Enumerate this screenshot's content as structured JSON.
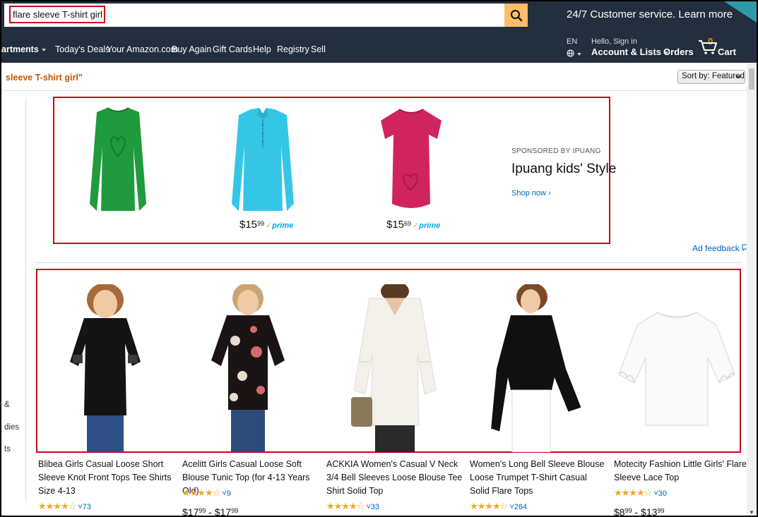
{
  "search": {
    "value": "flare sleeve T-shirt girl",
    "button_icon": "search-icon"
  },
  "promo": {
    "text": "24/7 Customer service. Learn more"
  },
  "nav": {
    "departments": "artments",
    "links": [
      "Today's Deals",
      "Your Amazon.com",
      "Buy Again",
      "Gift Cards",
      "Help",
      "Registry",
      "Sell"
    ],
    "language": "EN",
    "hello": "Hello, Sign in",
    "account": "Account & Lists",
    "orders": "Orders",
    "cart_count": "0",
    "cart": "Cart"
  },
  "results": {
    "query": "sleeve T-shirt girl\"",
    "sort_label": "Sort by:",
    "sort_value": "Featured"
  },
  "sidebar": {
    "fragments": [
      "&",
      "dies",
      "ts"
    ]
  },
  "sponsored": {
    "label": "SPONSORED BY IPUANG",
    "title": "Ipuang kids' Style",
    "shop_now": "Shop now ›",
    "products": [
      {
        "color": "#1f9a3c",
        "type": "long-sleeve"
      },
      {
        "color": "#35c6e6",
        "type": "polo",
        "price_whole": "15",
        "price_frac": "99",
        "prime": "prime"
      },
      {
        "color": "#d0245e",
        "type": "tee",
        "price_whole": "15",
        "price_frac": "69",
        "prime": "prime"
      }
    ]
  },
  "ad_feedback": "Ad feedback",
  "products": [
    {
      "title": "Blibea Girls Casual Loose Short Sleeve Knot Front Tops Tee Shirts Size 4-13",
      "stars": "★★★★☆",
      "reviews": "73",
      "price": "",
      "shirt_color": "#141414"
    },
    {
      "title": "Acelitt Girls Casual Loose Soft Blouse Tunic Top (for 4-13 Years Old)",
      "stars": "★★★★☆",
      "reviews": "9",
      "price_whole1": "17",
      "price_frac1": "99",
      "price_whole2": "17",
      "price_frac2": "99",
      "shirt_color": "#1a1414"
    },
    {
      "title": "ACKKIA Women's Casual V Neck 3/4 Bell Sleeves Loose Blouse Tee Shirt Solid Top",
      "stars": "★★★★☆",
      "reviews": "33",
      "shirt_color": "#f4f1ea"
    },
    {
      "title": "Women's Long Bell Sleeve Blouse Loose Trumpet T-Shirt Casual Solid Flare Tops",
      "stars": "★★★★☆",
      "reviews": "264",
      "shirt_color": "#101010"
    },
    {
      "title": "Motecity Fashion Little Girls' Flare Sleeve Lace Top",
      "stars": "★★★★☆",
      "reviews": "30",
      "price_whole1": "8",
      "price_frac1": "99",
      "price_whole2": "13",
      "price_frac2": "99",
      "shirt_color": "#fafafa"
    }
  ]
}
